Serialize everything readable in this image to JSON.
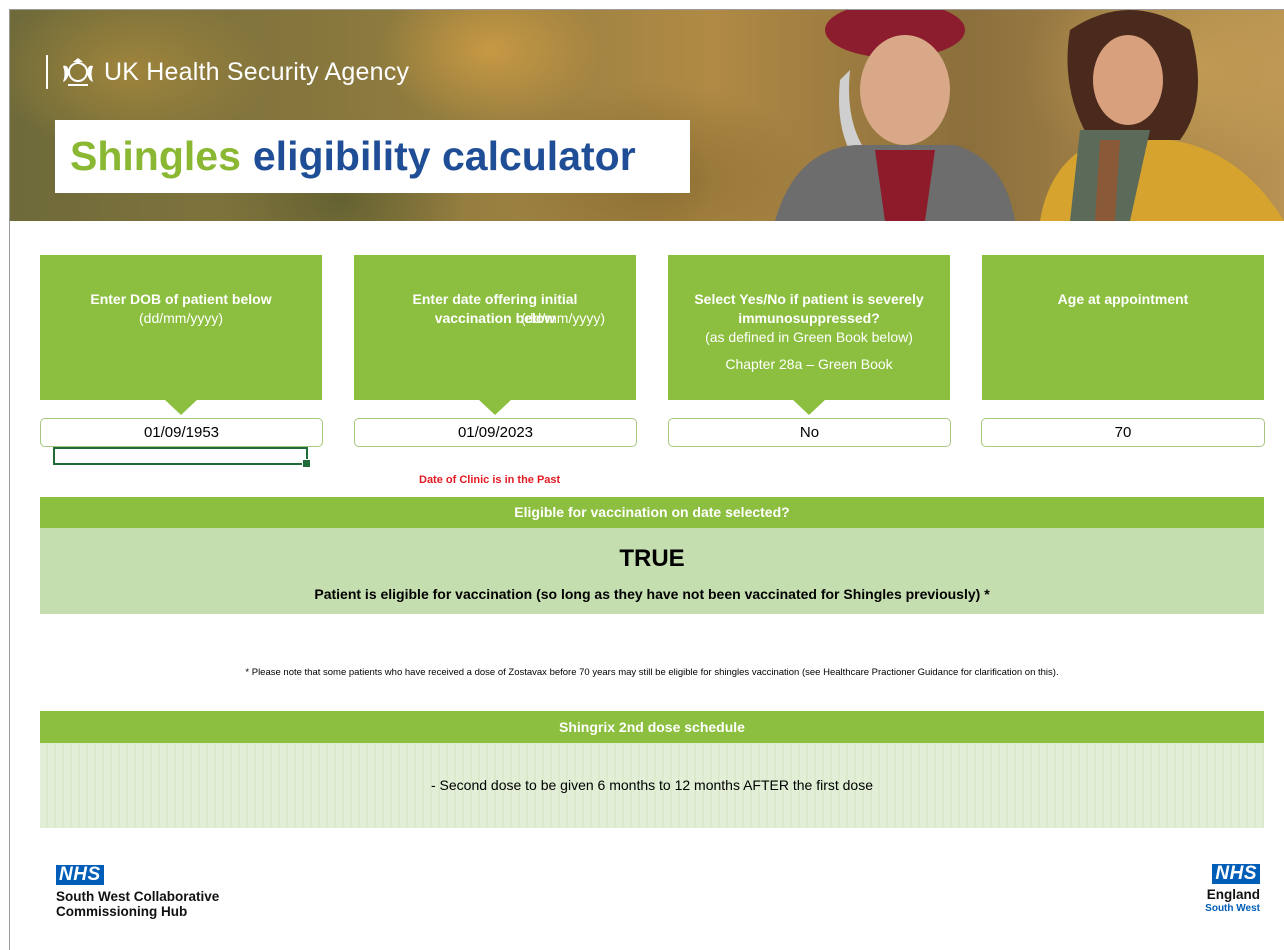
{
  "header": {
    "agency": "UK Health Security Agency",
    "title_part1": "Shingles",
    "title_part2": "eligibility calculator"
  },
  "inputs": {
    "dob": {
      "label": "Enter DOB of patient below",
      "format": "(dd/mm/yyyy)",
      "value": "01/09/1953"
    },
    "vacc_date": {
      "label": "Enter date offering initial vaccination below",
      "format": "(dd/mm/yyyy)",
      "value": "01/09/2023"
    },
    "immuno": {
      "label": "Select Yes/No if patient is severely immunosuppressed?",
      "sub": "(as defined in Green Book below)",
      "link": "Chapter 28a – Green Book",
      "value": "No"
    },
    "age": {
      "label": "Age at appointment",
      "value": "70"
    },
    "warning": "Date of Clinic is in the Past"
  },
  "result": {
    "header": "Eligible for vaccination on date selected?",
    "value": "TRUE",
    "message": "Patient is eligible for vaccination (so long as they have not been vaccinated for Shingles previously) *"
  },
  "footnote": "* Please note that some patients who have received a dose of Zostavax before 70 years may still be eligible for shingles vaccination (see Healthcare Practioner Guidance for clarification on this).",
  "schedule": {
    "header": "Shingrix 2nd dose schedule",
    "text": "- Second dose to be given 6 months to 12 months AFTER the first dose"
  },
  "logos": {
    "left": {
      "nhs": "NHS",
      "line1": "South West Collaborative",
      "line2": "Commissioning Hub"
    },
    "right": {
      "nhs": "NHS",
      "line1": "England",
      "line2": "South West"
    }
  },
  "colors": {
    "green": "#8cbf3f",
    "light_green": "#c5deb0",
    "title_green": "#8ab833",
    "title_blue": "#1f4e96",
    "warning_red": "#e31b23",
    "nhs_blue": "#005eb8"
  }
}
